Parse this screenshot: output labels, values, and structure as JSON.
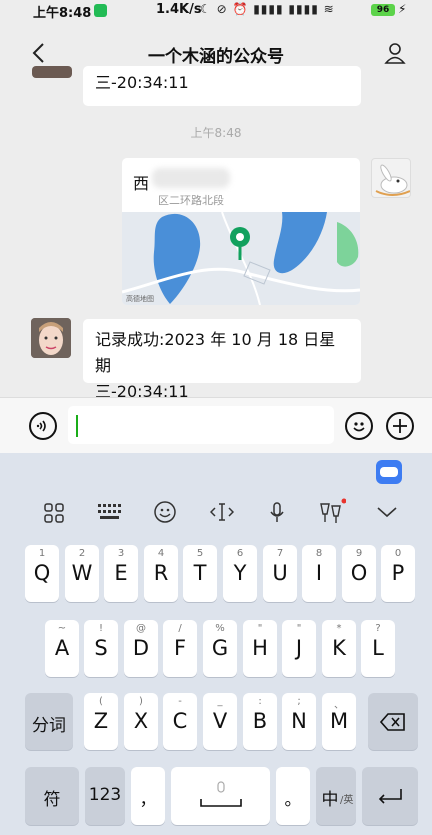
{
  "status_bar": {
    "time": "上午8:48",
    "network_speed": "1.4K/s",
    "icons_text": "☾ ⊘ ⏰ ▮▮▮▮ ▮▮▮▮ ≋",
    "battery": "96"
  },
  "nav": {
    "title": "一个木涵的公众号"
  },
  "chat": {
    "partial_message": "三-20:34:11",
    "timestamp": "上午8:48",
    "location": {
      "name": "西",
      "address": "区二环路北段",
      "map_label": "高德地图"
    },
    "message_line1": "记录成功:2023 年 10 月 18 日星期",
    "message_line2": "三-20:34:11"
  },
  "keyboard": {
    "row1": [
      {
        "sup": "1",
        "key": "Q"
      },
      {
        "sup": "2",
        "key": "W"
      },
      {
        "sup": "3",
        "key": "E"
      },
      {
        "sup": "4",
        "key": "R"
      },
      {
        "sup": "5",
        "key": "T"
      },
      {
        "sup": "6",
        "key": "Y"
      },
      {
        "sup": "7",
        "key": "U"
      },
      {
        "sup": "8",
        "key": "I"
      },
      {
        "sup": "9",
        "key": "O"
      },
      {
        "sup": "0",
        "key": "P"
      }
    ],
    "row2": [
      {
        "sup": "~",
        "key": "A"
      },
      {
        "sup": "!",
        "key": "S"
      },
      {
        "sup": "@",
        "key": "D"
      },
      {
        "sup": "/",
        "key": "F"
      },
      {
        "sup": "%",
        "key": "G"
      },
      {
        "sup": "\"",
        "key": "H"
      },
      {
        "sup": "\"",
        "key": "J"
      },
      {
        "sup": "*",
        "key": "K"
      },
      {
        "sup": "?",
        "key": "L"
      }
    ],
    "row3": [
      {
        "sup": "(",
        "key": "Z"
      },
      {
        "sup": ")",
        "key": "X"
      },
      {
        "sup": "-",
        "key": "C"
      },
      {
        "sup": "_",
        "key": "V"
      },
      {
        "sup": ":",
        "key": "B"
      },
      {
        "sup": ";",
        "key": "N"
      },
      {
        "sup": "、",
        "key": "M"
      }
    ],
    "fenci": "分词",
    "fu": "符",
    "num": "123",
    "comma": "，",
    "period": "。",
    "zh": "中",
    "en_small": "/英"
  }
}
